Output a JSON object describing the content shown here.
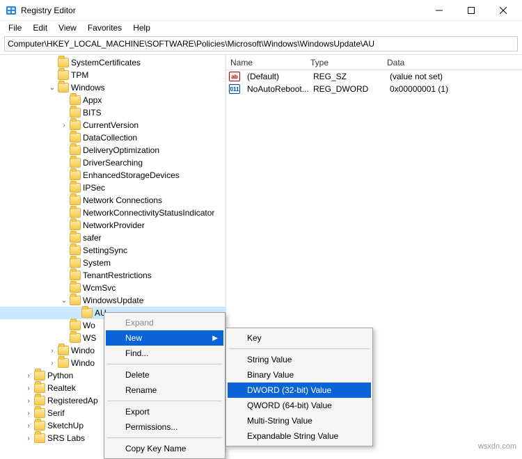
{
  "window": {
    "title": "Registry Editor"
  },
  "menus": [
    "File",
    "Edit",
    "View",
    "Favorites",
    "Help"
  ],
  "address": "Computer\\HKEY_LOCAL_MACHINE\\SOFTWARE\\Policies\\Microsoft\\Windows\\WindowsUpdate\\AU",
  "tree": [
    {
      "d": 4,
      "e": "",
      "label": "SystemCertificates"
    },
    {
      "d": 4,
      "e": "",
      "label": "TPM"
    },
    {
      "d": 4,
      "e": "v",
      "label": "Windows"
    },
    {
      "d": 5,
      "e": "",
      "label": "Appx"
    },
    {
      "d": 5,
      "e": "",
      "label": "BITS"
    },
    {
      "d": 5,
      "e": ">",
      "label": "CurrentVersion"
    },
    {
      "d": 5,
      "e": "",
      "label": "DataCollection"
    },
    {
      "d": 5,
      "e": "",
      "label": "DeliveryOptimization"
    },
    {
      "d": 5,
      "e": "",
      "label": "DriverSearching"
    },
    {
      "d": 5,
      "e": "",
      "label": "EnhancedStorageDevices"
    },
    {
      "d": 5,
      "e": "",
      "label": "IPSec"
    },
    {
      "d": 5,
      "e": "",
      "label": "Network Connections"
    },
    {
      "d": 5,
      "e": "",
      "label": "NetworkConnectivityStatusIndicator"
    },
    {
      "d": 5,
      "e": "",
      "label": "NetworkProvider"
    },
    {
      "d": 5,
      "e": "",
      "label": "safer"
    },
    {
      "d": 5,
      "e": "",
      "label": "SettingSync"
    },
    {
      "d": 5,
      "e": "",
      "label": "System"
    },
    {
      "d": 5,
      "e": "",
      "label": "TenantRestrictions"
    },
    {
      "d": 5,
      "e": "",
      "label": "WcmSvc"
    },
    {
      "d": 5,
      "e": "v",
      "label": "WindowsUpdate"
    },
    {
      "d": 6,
      "e": "",
      "label": "AU",
      "selected": true
    },
    {
      "d": 5,
      "e": "",
      "label": "Wo"
    },
    {
      "d": 5,
      "e": "",
      "label": "WS"
    },
    {
      "d": 4,
      "e": ">",
      "label": "Windo"
    },
    {
      "d": 4,
      "e": ">",
      "label": "Windo"
    },
    {
      "d": 2,
      "e": ">",
      "label": "Python"
    },
    {
      "d": 2,
      "e": ">",
      "label": "Realtek"
    },
    {
      "d": 2,
      "e": ">",
      "label": "RegisteredAp"
    },
    {
      "d": 2,
      "e": ">",
      "label": "Serif"
    },
    {
      "d": 2,
      "e": ">",
      "label": "SketchUp"
    },
    {
      "d": 2,
      "e": ">",
      "label": "SRS Labs"
    }
  ],
  "list": {
    "headers": {
      "name": "Name",
      "type": "Type",
      "data": "Data"
    },
    "rows": [
      {
        "icon": "sz",
        "name": "(Default)",
        "type": "REG_SZ",
        "data": "(value not set)"
      },
      {
        "icon": "dw",
        "name": "NoAutoReboot...",
        "type": "REG_DWORD",
        "data": "0x00000001 (1)"
      }
    ]
  },
  "ctx1": {
    "items": [
      {
        "label": "Expand",
        "kind": "disabled"
      },
      {
        "label": "New",
        "kind": "highlight",
        "arrow": true
      },
      {
        "label": "Find...",
        "kind": ""
      },
      {
        "sep": true
      },
      {
        "label": "Delete",
        "kind": ""
      },
      {
        "label": "Rename",
        "kind": ""
      },
      {
        "sep": true
      },
      {
        "label": "Export",
        "kind": ""
      },
      {
        "label": "Permissions...",
        "kind": ""
      },
      {
        "sep": true
      },
      {
        "label": "Copy Key Name",
        "kind": ""
      }
    ]
  },
  "ctx2": {
    "items": [
      {
        "label": "Key"
      },
      {
        "sep": true
      },
      {
        "label": "String Value"
      },
      {
        "label": "Binary Value"
      },
      {
        "label": "DWORD (32-bit) Value",
        "kind": "highlight"
      },
      {
        "label": "QWORD (64-bit) Value"
      },
      {
        "label": "Multi-String Value"
      },
      {
        "label": "Expandable String Value"
      }
    ]
  },
  "watermark": "wsxdn.com"
}
